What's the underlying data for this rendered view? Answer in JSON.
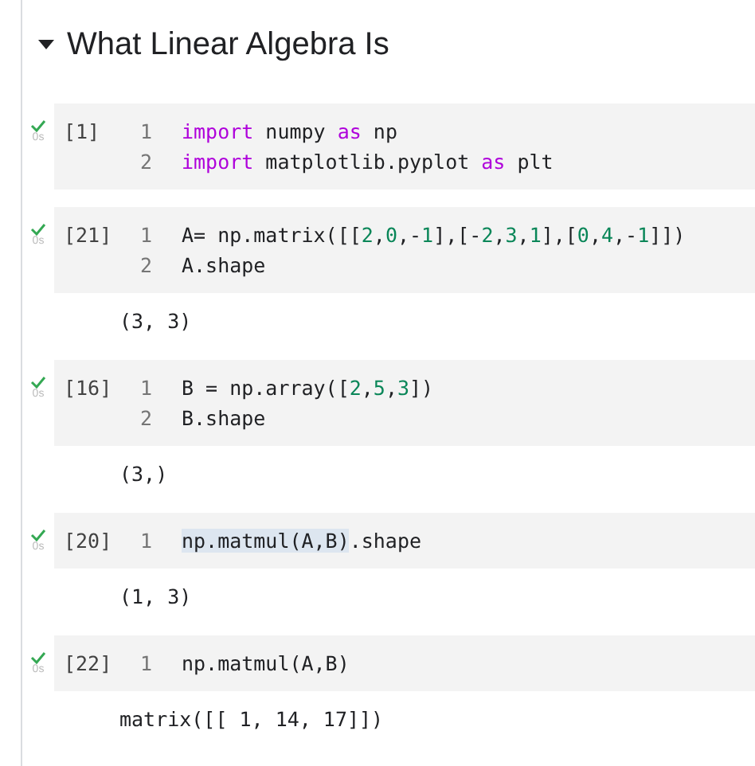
{
  "section": {
    "title": "What Linear Algebra Is",
    "expanded": true
  },
  "cells": [
    {
      "count": "[1]",
      "status": "0s",
      "done": true,
      "lines": [
        {
          "number": "1",
          "tokens": [
            {
              "kind": "keyword",
              "text": "import"
            },
            {
              "kind": "plain",
              "text": " numpy "
            },
            {
              "kind": "keyword",
              "text": "as"
            },
            {
              "kind": "plain",
              "text": " np"
            }
          ]
        },
        {
          "number": "2",
          "tokens": [
            {
              "kind": "keyword",
              "text": "import"
            },
            {
              "kind": "plain",
              "text": " matplotlib.pyplot "
            },
            {
              "kind": "keyword",
              "text": "as"
            },
            {
              "kind": "plain",
              "text": " plt"
            }
          ]
        }
      ]
    },
    {
      "count": "[21]",
      "status": "0s",
      "done": true,
      "output": "(3, 3)",
      "lines": [
        {
          "number": "1",
          "tokens": [
            {
              "kind": "plain",
              "text": "A= np.matrix([["
            },
            {
              "kind": "number",
              "text": "2"
            },
            {
              "kind": "plain",
              "text": ","
            },
            {
              "kind": "number",
              "text": "0"
            },
            {
              "kind": "plain",
              "text": ",-"
            },
            {
              "kind": "number",
              "text": "1"
            },
            {
              "kind": "plain",
              "text": "],[-"
            },
            {
              "kind": "number",
              "text": "2"
            },
            {
              "kind": "plain",
              "text": ","
            },
            {
              "kind": "number",
              "text": "3"
            },
            {
              "kind": "plain",
              "text": ","
            },
            {
              "kind": "number",
              "text": "1"
            },
            {
              "kind": "plain",
              "text": "],["
            },
            {
              "kind": "number",
              "text": "0"
            },
            {
              "kind": "plain",
              "text": ","
            },
            {
              "kind": "number",
              "text": "4"
            },
            {
              "kind": "plain",
              "text": ",-"
            },
            {
              "kind": "number",
              "text": "1"
            },
            {
              "kind": "plain",
              "text": "]])"
            }
          ]
        },
        {
          "number": "2",
          "tokens": [
            {
              "kind": "plain",
              "text": "A.shape"
            }
          ]
        }
      ]
    },
    {
      "count": "[16]",
      "status": "0s",
      "done": true,
      "output": "(3,)",
      "lines": [
        {
          "number": "1",
          "tokens": [
            {
              "kind": "plain",
              "text": "B = np.array(["
            },
            {
              "kind": "number",
              "text": "2"
            },
            {
              "kind": "plain",
              "text": ","
            },
            {
              "kind": "number",
              "text": "5"
            },
            {
              "kind": "plain",
              "text": ","
            },
            {
              "kind": "number",
              "text": "3"
            },
            {
              "kind": "plain",
              "text": "])"
            }
          ]
        },
        {
          "number": "2",
          "tokens": [
            {
              "kind": "plain",
              "text": "B.shape"
            }
          ]
        }
      ]
    },
    {
      "count": "[20]",
      "status": "0s",
      "done": true,
      "output": "(1, 3)",
      "lines": [
        {
          "number": "1",
          "tokens": [
            {
              "kind": "selected",
              "text": "np.matmul(A,B)"
            },
            {
              "kind": "plain",
              "text": ".shape"
            }
          ]
        }
      ]
    },
    {
      "count": "[22]",
      "status": "0s",
      "done": true,
      "output": "matrix([[ 1, 14, 17]])",
      "lines": [
        {
          "number": "1",
          "tokens": [
            {
              "kind": "plain",
              "text": "np.matmul(A,B)"
            }
          ]
        }
      ]
    }
  ]
}
